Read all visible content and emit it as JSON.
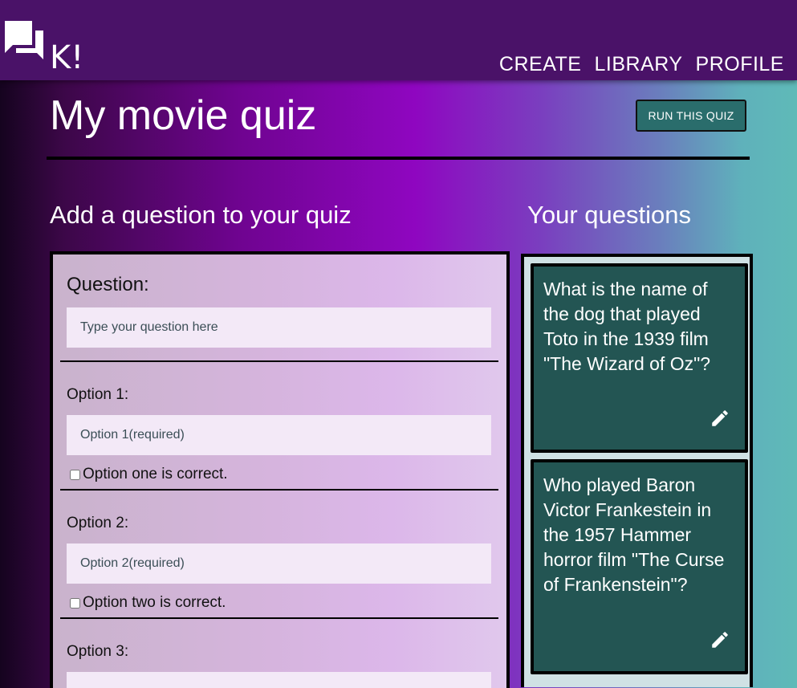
{
  "header": {
    "logo_text": "K!",
    "nav": [
      {
        "label": "CREATE"
      },
      {
        "label": "LIBRARY"
      },
      {
        "label": "PROFILE"
      }
    ]
  },
  "page": {
    "title": "My movie quiz",
    "run_button_label": "RUN THIS QUIZ"
  },
  "form": {
    "heading": "Add a question to your quiz",
    "question_label": "Question:",
    "question_placeholder": "Type your question here",
    "options": [
      {
        "label": "Option 1:",
        "placeholder": "Option 1(required)",
        "correct_label": "Option one is correct."
      },
      {
        "label": "Option 2:",
        "placeholder": "Option 2(required)",
        "correct_label": "Option two is correct."
      },
      {
        "label": "Option 3:"
      }
    ]
  },
  "questions": {
    "heading": "Your questions",
    "items": [
      {
        "text": "What is the name of the dog that played Toto in the 1939 film \"The Wizard of Oz\"?",
        "icon": "pencil-icon"
      },
      {
        "text": "Who played Baron Victor Frankestein in the 1957 Hammer horror film \"The Curse of Frankenstein\"?",
        "icon": "pencil-icon"
      }
    ]
  },
  "colors": {
    "header_bg": "#4a1268",
    "accent_teal": "#2a6d6c",
    "card_bg": "#235553"
  }
}
